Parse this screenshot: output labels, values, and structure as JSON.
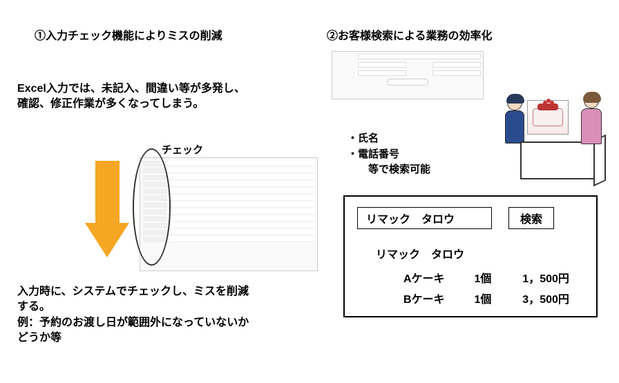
{
  "left": {
    "heading": "①入力チェック機能によりミスの削減",
    "problem_text": "Excel入力では、未記入、間違い等が多発し、確認、修正作業が多くなってしまう。",
    "check_label": "チェック",
    "solution_text": "入力時に、システムでチェックし、ミスを削減する。\n例：予約のお渡し日が範囲外になっていないかどうか等"
  },
  "right": {
    "heading": "②お客様検索による業務の効率化",
    "search_criteria": {
      "line1": "・氏名",
      "line2": "・電話番号",
      "line3": "　　等で検索可能"
    },
    "result": {
      "query_name": "リマック　タロウ",
      "search_button": "検索",
      "found_name": "リマック　タロウ",
      "items": [
        {
          "name": "Aケーキ",
          "qty": "1個",
          "price": "1，500円"
        },
        {
          "name": "Bケーキ",
          "qty": "1個",
          "price": "3，500円"
        }
      ]
    }
  }
}
